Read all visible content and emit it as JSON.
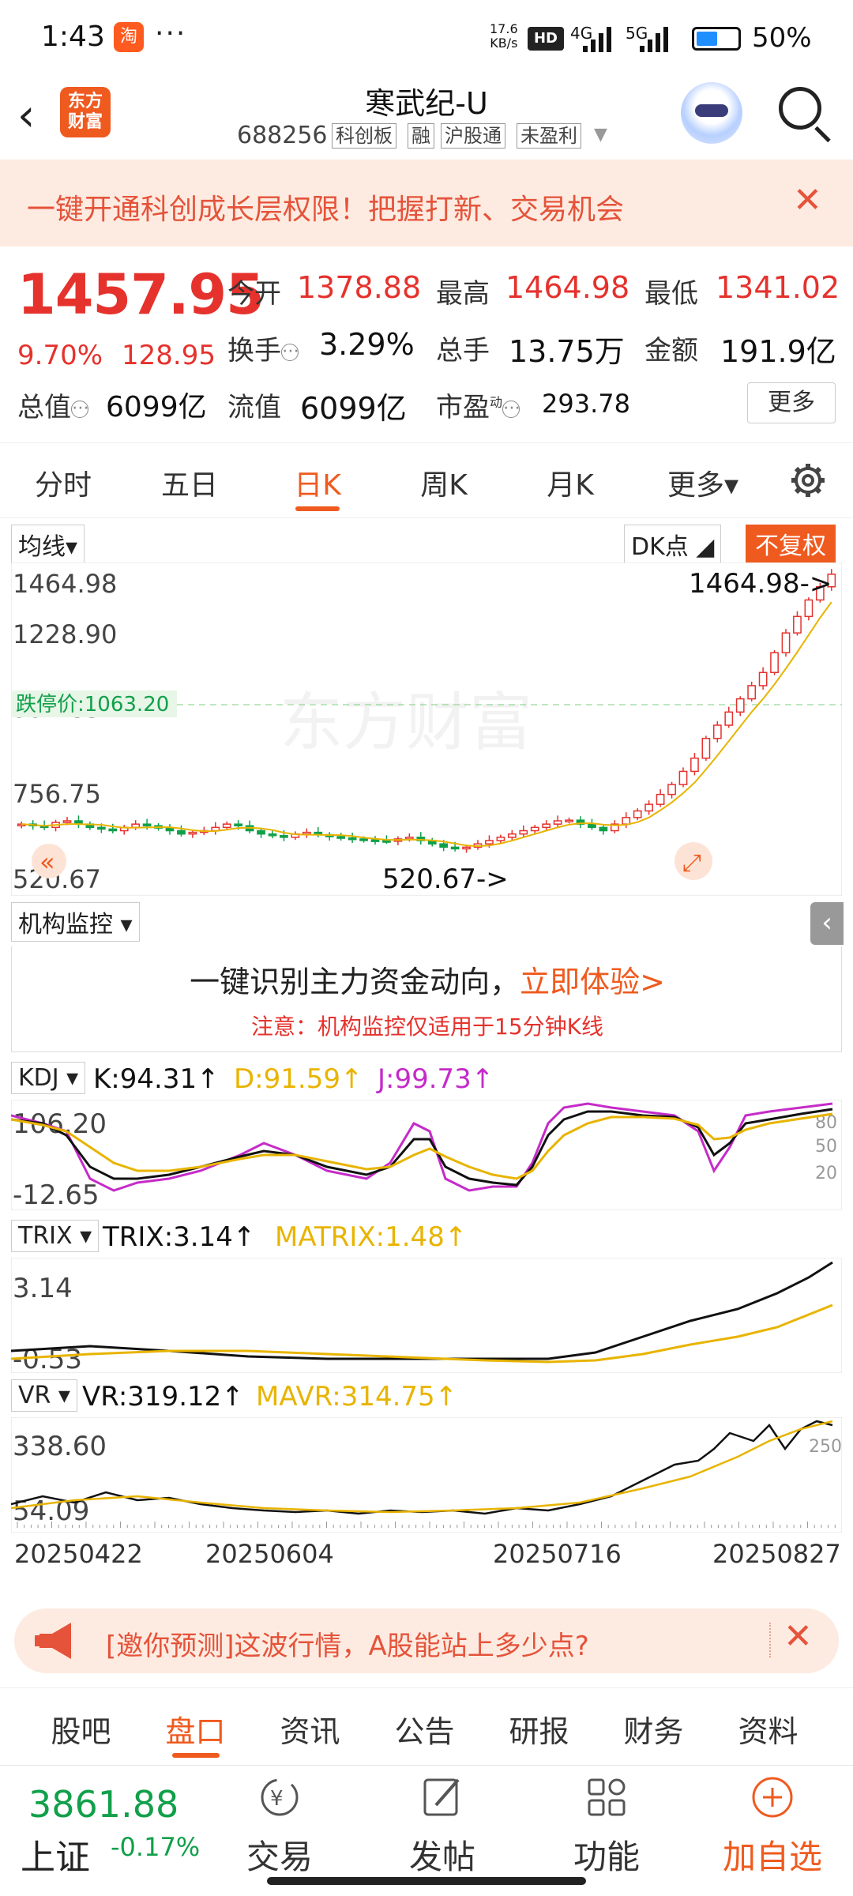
{
  "status_bar": {
    "time": "1:43",
    "dots": "···",
    "app_icon": "淘",
    "net_speed_value": "17.6",
    "net_speed_unit": "KB/s",
    "hd": "HD",
    "signal1": "4G",
    "signal2": "5G",
    "battery": "50%"
  },
  "header": {
    "logo": "东方财富",
    "title": "寒武纪-U",
    "code": "688256",
    "tags": [
      "科创板",
      "融",
      "沪股通",
      "未盈利"
    ]
  },
  "promo": {
    "text": "一键开通科创成长层权限！把握打新、交易机会"
  },
  "quote": {
    "price": "1457.95",
    "pct": "9.70%",
    "change": "128.95",
    "open_label": "今开",
    "open": "1378.88",
    "high_label": "最高",
    "high": "1464.98",
    "low_label": "最低",
    "low": "1341.02",
    "turnover_label": "换手",
    "turnover": "3.29%",
    "volume_label": "总手",
    "volume": "13.75万",
    "amount_label": "金额",
    "amount": "191.9亿",
    "mktcap_label": "总值",
    "mktcap": "6099亿",
    "float_label": "流值",
    "float": "6099亿",
    "pe_label": "市盈",
    "pe_sup": "动",
    "pe": "293.78",
    "more": "更多"
  },
  "ktabs": [
    "分时",
    "五日",
    "日K",
    "周K",
    "月K",
    "更多▾"
  ],
  "chart_bar": {
    "ma": "均线▾",
    "dk": "DK点 ◢",
    "fq": "不复权"
  },
  "chart_data": {
    "type": "candlestick",
    "y_ticks": [
      "1464.98",
      "1228.90",
      "992.83",
      "756.75",
      "520.67"
    ],
    "ylim": [
      520.67,
      1464.98
    ],
    "high_marker": "1464.98->",
    "low_marker": "520.67->",
    "limit_down_label": "跌停价:1063.20",
    "limit_down_value": 1063.2,
    "x_ticks": [
      "20250422",
      "20250604",
      "20250716",
      "20250827"
    ],
    "watermark": "东方财富",
    "closes": [
      700,
      695,
      690,
      705,
      710,
      700,
      690,
      685,
      680,
      690,
      700,
      695,
      688,
      680,
      670,
      675,
      680,
      690,
      700,
      695,
      680,
      670,
      665,
      660,
      670,
      675,
      668,
      662,
      658,
      655,
      652,
      650,
      648,
      655,
      660,
      650,
      640,
      630,
      625,
      630,
      640,
      650,
      660,
      670,
      680,
      690,
      700,
      710,
      712,
      700,
      690,
      680,
      700,
      720,
      740,
      760,
      790,
      820,
      860,
      900,
      960,
      1000,
      1040,
      1080,
      1120,
      1160,
      1220,
      1280,
      1330,
      1380,
      1420,
      1458
    ]
  },
  "inst": {
    "label": "机构监控 ▾",
    "main_text": "一键识别主力资金动向，",
    "link_text": "立即体验>",
    "note": "注意：机构监控仅适用于15分钟K线",
    "collapse": "‹"
  },
  "kdj": {
    "label": "KDJ ▾",
    "k": "K:94.31↑",
    "d": "D:91.59↑",
    "j": "J:99.73↑",
    "y_top": "106.20",
    "y_bottom": "-12.65",
    "levels": [
      "80",
      "50",
      "20"
    ]
  },
  "trix": {
    "label": "TRIX ▾",
    "trix": "TRIX:3.14↑",
    "matrix": "MATRIX:1.48↑",
    "y_top": "3.14",
    "y_bottom": "-0.53"
  },
  "vr": {
    "label": "VR ▾",
    "vr": "VR:319.12↑",
    "mavr": "MAVR:314.75↑",
    "y_top": "338.60",
    "y_bottom": "54.09",
    "level": "250"
  },
  "invite": {
    "text": "[邀你预测]这波行情，A股能站上多少点?"
  },
  "btabs": [
    "股吧",
    "盘口",
    "资讯",
    "公告",
    "研报",
    "财务",
    "资料"
  ],
  "bottom": {
    "index_value": "3861.88",
    "index_name": "上证",
    "index_change": "-0.17%",
    "trade": "交易",
    "post": "发帖",
    "func": "功能",
    "add": "加自选"
  },
  "colors": {
    "accent": "#ef5a1f",
    "up": "#e5322d",
    "down": "#11a04a",
    "kdj_d": "#e8b400",
    "kdj_j": "#c52bc8"
  }
}
